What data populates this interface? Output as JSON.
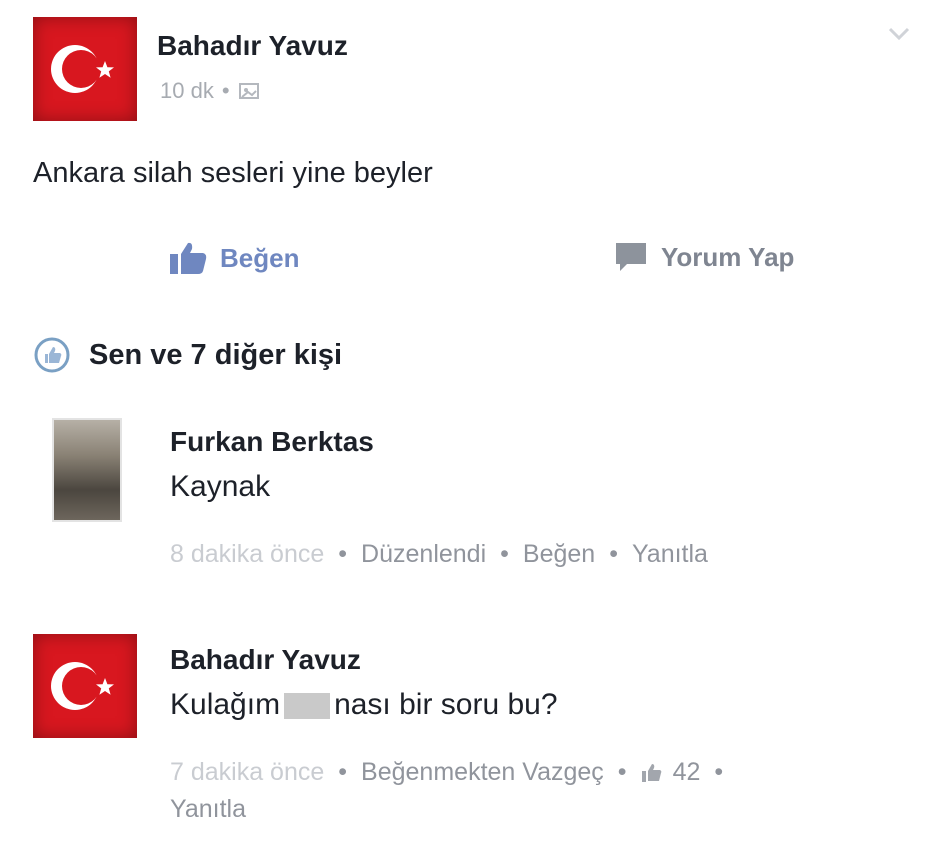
{
  "post": {
    "author": "Bahadır Yavuz",
    "time": "10 dk",
    "time_separator": "•",
    "text": "Ankara silah sesleri yine beyler",
    "actions": {
      "like": "Beğen",
      "comment": "Yorum Yap"
    },
    "reactions_summary": "Sen ve 7 diğer kişi"
  },
  "comments": [
    {
      "author": "Furkan Berktas",
      "text": "Kaynak",
      "time": "8 dakika önce",
      "links": [
        "Düzenlendi",
        "Beğen",
        "Yanıtla"
      ]
    },
    {
      "author": "Bahadır Yavuz",
      "text_before": "Kulağım",
      "text_after": "nası bir soru bu?",
      "time": "7 dakika önce",
      "unlike": "Beğenmekten Vazgeç",
      "like_count": "42",
      "reply": "Yanıtla"
    }
  ],
  "colors": {
    "flag": "#d8171f",
    "like_blue": "#6f87c0",
    "text": "#1d2129",
    "meta": "#90949c"
  }
}
